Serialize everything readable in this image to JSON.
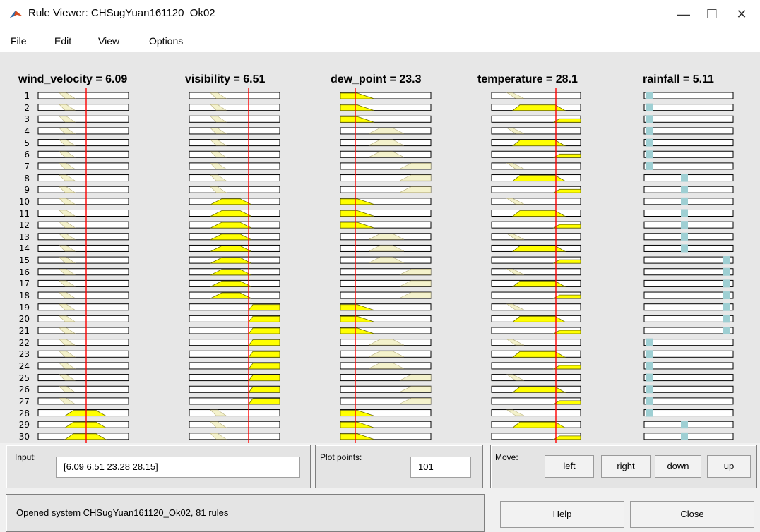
{
  "window": {
    "title": "Rule Viewer: CHSugYuan161120_Ok02",
    "minimize_glyph": "—",
    "maximize_glyph": "☐",
    "close_glyph": "✕"
  },
  "menu": {
    "file": "File",
    "edit": "Edit",
    "view": "View",
    "options": "Options"
  },
  "variables": [
    {
      "label": "wind_velocity = 6.09",
      "value": 6.09
    },
    {
      "label": "visibility = 6.51",
      "value": 6.51
    },
    {
      "label": "dew_point = 23.3",
      "value": 23.3
    },
    {
      "label": "temperature = 28.1",
      "value": 28.1
    },
    {
      "label": "rainfall = 5.11",
      "value": 5.11
    }
  ],
  "rule_numbers": [
    "1",
    "2",
    "3",
    "4",
    "5",
    "6",
    "7",
    "8",
    "9",
    "10",
    "11",
    "12",
    "13",
    "14",
    "15",
    "16",
    "17",
    "18",
    "19",
    "20",
    "21",
    "22",
    "23",
    "24",
    "25",
    "26",
    "27",
    "28",
    "29",
    "30"
  ],
  "colors": {
    "input_fill": "#ffff00",
    "output_fill": "#9ecfd3",
    "indicator_line": "#ff0000",
    "faint_mf": "#f4f2cc"
  },
  "controls": {
    "input_label": "Input:",
    "input_value": "[6.09 6.51 23.28 28.15]",
    "plot_points_label": "Plot points:",
    "plot_points_value": "101",
    "move_label": "Move:",
    "left": "left",
    "right": "right",
    "down": "down",
    "up": "up",
    "help": "Help",
    "close": "Close",
    "status": "Opened system CHSugYuan161120_Ok02, 81 rules"
  }
}
